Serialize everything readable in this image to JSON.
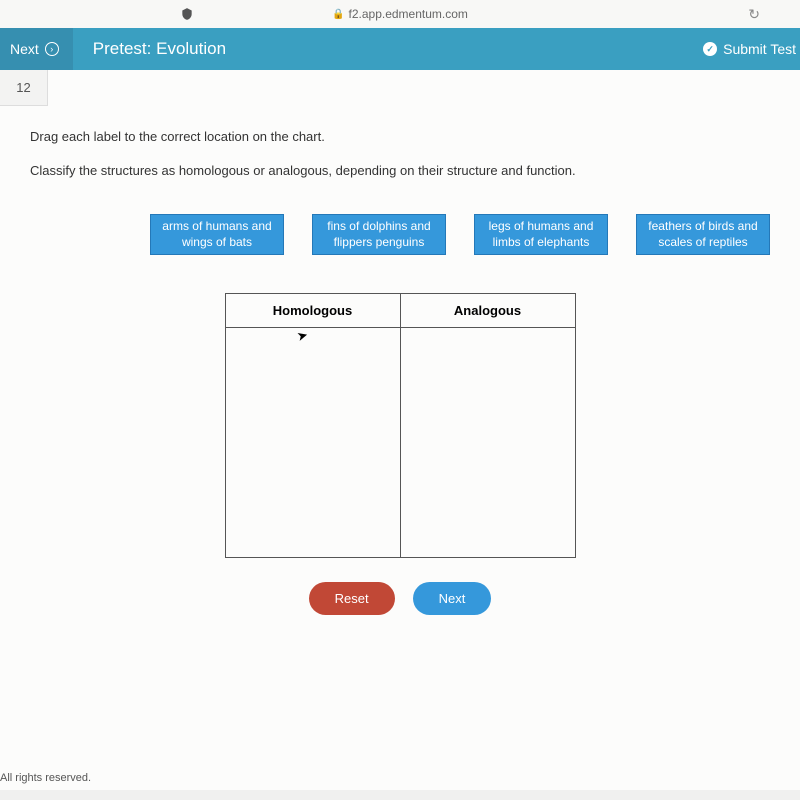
{
  "browser": {
    "url": "f2.app.edmentum.com"
  },
  "header": {
    "next_label": "Next",
    "title": "Pretest: Evolution",
    "submit_label": "Submit Test"
  },
  "question": {
    "number": "12",
    "instruction1": "Drag each label to the correct location on the chart.",
    "instruction2": "Classify the structures as homologous or analogous, depending on their structure and function."
  },
  "labels": [
    "arms of humans and wings of bats",
    "fins of dolphins and flippers penguins",
    "legs of humans and limbs of elephants",
    "feathers of birds and scales of reptiles"
  ],
  "table": {
    "col1": "Homologous",
    "col2": "Analogous"
  },
  "buttons": {
    "reset": "Reset",
    "next": "Next"
  },
  "footer": "All rights reserved."
}
